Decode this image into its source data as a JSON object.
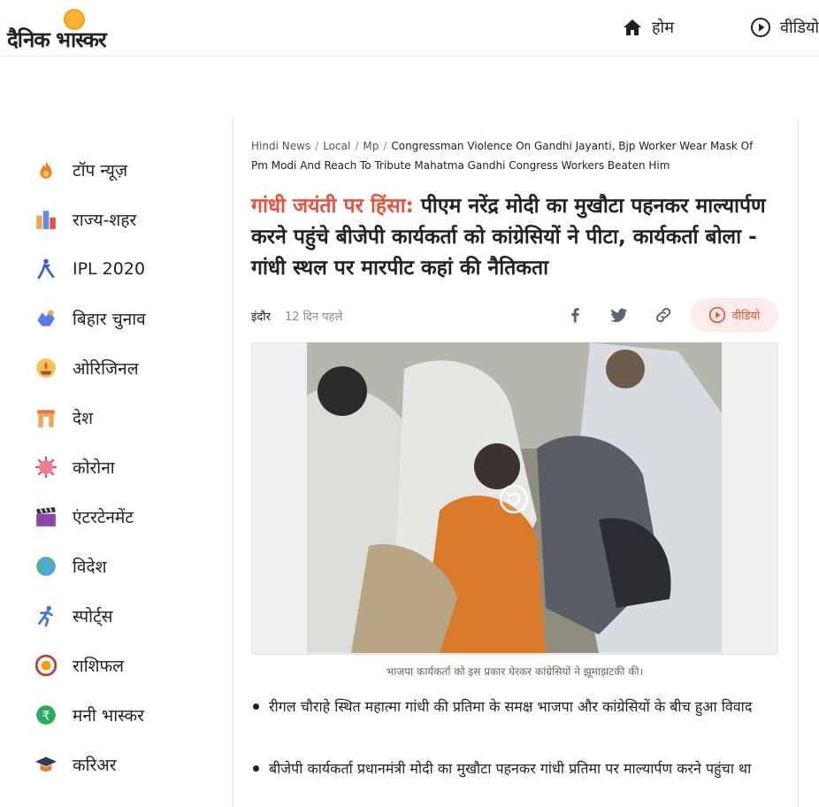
{
  "header": {
    "logo_text": "दैनिक भास्कर",
    "nav": [
      {
        "label": "होम",
        "icon": "home-icon"
      },
      {
        "label": "वीडियो",
        "icon": "play-circle-icon"
      }
    ]
  },
  "sidebar": {
    "items": [
      {
        "label": "टॉप न्यूज़",
        "icon": "flame-icon"
      },
      {
        "label": "राज्य-शहर",
        "icon": "city-icon"
      },
      {
        "label": "IPL 2020",
        "icon": "cricket-icon"
      },
      {
        "label": "बिहार चुनाव",
        "icon": "election-icon"
      },
      {
        "label": "ओरिजिनल",
        "icon": "diya-icon"
      },
      {
        "label": "देश",
        "icon": "india-gate-icon"
      },
      {
        "label": "कोरोना",
        "icon": "virus-icon"
      },
      {
        "label": "एंटरटेनमेंट",
        "icon": "clapperboard-icon"
      },
      {
        "label": "विदेश",
        "icon": "globe-icon"
      },
      {
        "label": "स्पोर्ट्स",
        "icon": "runner-icon"
      },
      {
        "label": "राशिफल",
        "icon": "zodiac-icon"
      },
      {
        "label": "मनी भास्कर",
        "icon": "rupee-icon"
      },
      {
        "label": "करिअर",
        "icon": "graduation-cap-icon"
      }
    ]
  },
  "article": {
    "breadcrumb": [
      {
        "label": "Hindi News"
      },
      {
        "label": "Local"
      },
      {
        "label": "Mp"
      },
      {
        "label": "Congressman Violence On Gandhi Jayanti, Bjp Worker Wear Mask Of Pm Modi And Reach To Tribute Mahatma Gandhi Congress Workers Beaten Him"
      }
    ],
    "kicker": "गांधी जयंती पर हिंसा:",
    "headline": " पीएम नरेंद्र मोदी का मुखौटा पहनकर माल्यार्पण करने पहुंचे बीजेपी कार्यकर्ता को कांग्रेसियों ने पीटा, कार्यकर्ता बोला - गांधी स्थल पर मारपीट कहां की नैतिकता",
    "city": "इंदौर",
    "time": "12 दिन पहले",
    "share_icons": [
      "facebook-icon",
      "twitter-icon",
      "link-icon"
    ],
    "video_label": "वीडियो",
    "caption": "भाजपा कार्यकर्ता को इस प्रकार घेरकर कांग्रेसियों ने झूमाझटकी की।",
    "bullets": [
      "रीगल चौराहे स्थित महात्मा गांधी की प्रतिमा के समक्ष भाजपा और कांग्रेसियों के बीच हुआ विवाद",
      "बीजेपी कार्यकर्ता प्रधानमंत्री मोदी का मुखौटा पहनकर गांधी प्रतिमा पर माल्यार्पण करने पहुंचा था"
    ]
  },
  "colors": {
    "accent": "#e8513b",
    "video_pill_bg": "#fdecea",
    "logo_sun": "#f39c12"
  }
}
